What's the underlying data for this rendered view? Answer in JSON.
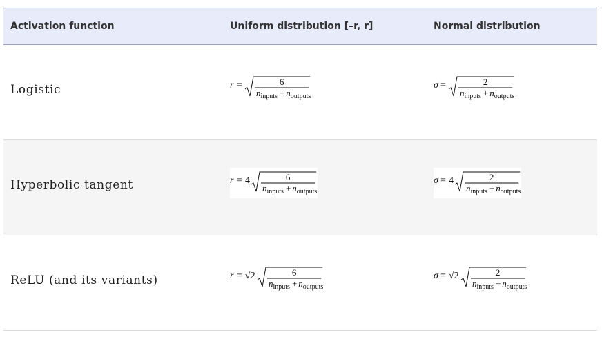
{
  "table": {
    "headers": [
      "Activation function",
      "Uniform distribution [–r, r]",
      "Normal distribution"
    ],
    "rows": [
      {
        "label": "Logistic",
        "uniform": {
          "var": "r",
          "coef": "",
          "num": "6",
          "den_a": "n",
          "den_a_sub": "inputs",
          "plus": "+",
          "den_b": "n",
          "den_b_sub": "outputs"
        },
        "normal": {
          "var": "σ",
          "coef": "",
          "num": "2",
          "den_a": "n",
          "den_a_sub": "inputs",
          "plus": "+",
          "den_b": "n",
          "den_b_sub": "outputs"
        }
      },
      {
        "label": "Hyperbolic tangent",
        "uniform": {
          "var": "r",
          "coef": "4",
          "num": "6",
          "den_a": "n",
          "den_a_sub": "inputs",
          "plus": "+",
          "den_b": "n",
          "den_b_sub": "outputs"
        },
        "normal": {
          "var": "σ",
          "coef": "4",
          "num": "2",
          "den_a": "n",
          "den_a_sub": "inputs",
          "plus": "+",
          "den_b": "n",
          "den_b_sub": "outputs"
        }
      },
      {
        "label": "ReLU (and its variants)",
        "uniform": {
          "var": "r",
          "coef": "√2",
          "num": "6",
          "den_a": "n",
          "den_a_sub": "inputs",
          "plus": "+",
          "den_b": "n",
          "den_b_sub": "outputs"
        },
        "normal": {
          "var": "σ",
          "coef": "√2",
          "num": "2",
          "den_a": "n",
          "den_a_sub": "inputs",
          "plus": "+",
          "den_b": "n",
          "den_b_sub": "outputs"
        }
      }
    ]
  }
}
